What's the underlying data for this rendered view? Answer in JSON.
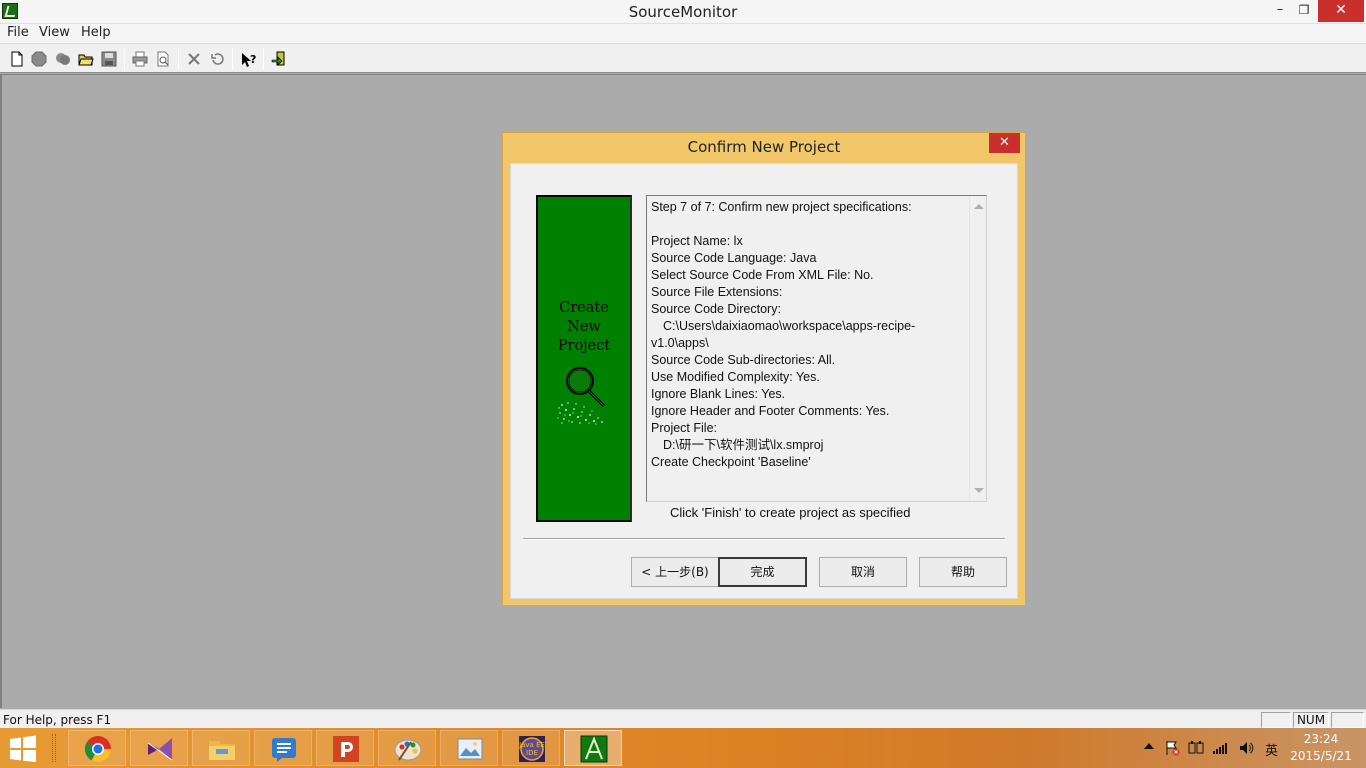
{
  "app": {
    "title": "SourceMonitor"
  },
  "window_controls": {
    "minimize": "–",
    "maximize": "❐",
    "close": "✕"
  },
  "menu": {
    "items": [
      {
        "label": "File"
      },
      {
        "label": "View"
      },
      {
        "label": "Help"
      }
    ]
  },
  "toolbar": {
    "icons": [
      "new-file-icon",
      "new-project-icon",
      "new-checkpoint-icon",
      "open-folder-icon",
      "save-icon",
      "print-icon",
      "print-preview-icon",
      "delete-icon",
      "undo-icon",
      "context-help-icon",
      "exit-icon"
    ]
  },
  "dialog": {
    "title": "Confirm New Project",
    "close_glyph": "✕",
    "panel_lines": [
      "Create",
      "New",
      "Project"
    ],
    "spec_lines": [
      "Step 7 of 7: Confirm new project specifications:",
      "",
      "Project Name: lx",
      "Source Code Language: Java",
      "Select Source Code From XML File: No.",
      "Source File Extensions:",
      "Source Code Directory:",
      "C:\\Users\\daixiaomao\\workspace\\apps-recipe-",
      "v1.0\\apps\\",
      "Source Code Sub-directories: All.",
      "Use Modified Complexity: Yes.",
      "Ignore Blank Lines: Yes.",
      "Ignore Header and Footer Comments: Yes.",
      "Project File:",
      "D:\\研一下\\软件测试\\lx.smproj",
      "Create Checkpoint 'Baseline'"
    ],
    "note": "Click 'Finish' to create project as specified",
    "buttons": {
      "back": "< 上一步(B)",
      "finish": "完成",
      "cancel": "取消",
      "help": "帮助"
    }
  },
  "status_bar": {
    "text": "For Help, press F1",
    "panes": [
      "",
      "NUM",
      ""
    ]
  },
  "taskbar": {
    "apps": [
      "chrome-icon",
      "visual-studio-icon",
      "file-explorer-icon",
      "notes-icon",
      "powerpoint-icon",
      "paint-icon",
      "photo-viewer-icon",
      "eclipse-javaee-icon",
      "sourcemonitor-icon"
    ],
    "tray": {
      "ime": "英",
      "time": "23:24",
      "date": "2015/5/21"
    }
  }
}
